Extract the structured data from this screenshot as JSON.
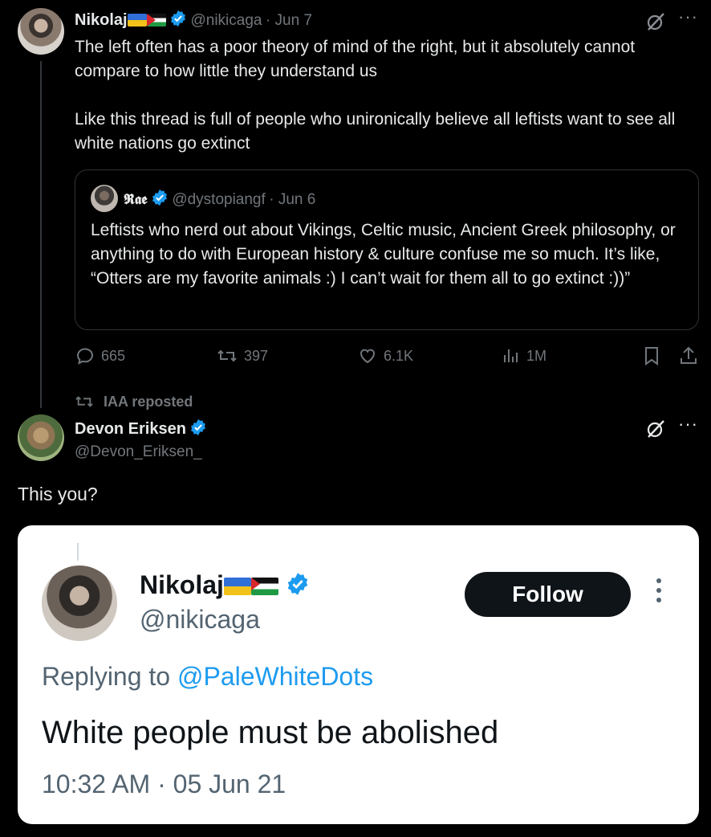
{
  "tweet": {
    "author_name": "Nikolaj",
    "author_handle": "@nikicaga",
    "date": "· Jun 7",
    "text_p1": "The left often has a poor theory of mind of the right, but it absolutely cannot compare to how little they understand us",
    "text_p2": "Like this thread is full of people who unironically believe all leftists want to see all white nations go extinct",
    "icons": [
      "grok-icon",
      "more-icon"
    ]
  },
  "quote": {
    "author_name": "𝕽𝖆𝖊",
    "author_handle": "@dystopiangf",
    "date": "· Jun 6",
    "text": "Leftists who nerd out about Vikings, Celtic music, Ancient Greek philosophy, or anything to do with European history & culture confuse me so much. It’s like, “Otters are my favorite animals :) I can’t wait for them all to go extinct :))”"
  },
  "actions": {
    "replies": "665",
    "reposts": "397",
    "likes": "6.1K",
    "views": "1M"
  },
  "repost": {
    "label": "IAA reposted",
    "author_name": "Devon Eriksen",
    "author_handle": "@Devon_Eriksen_",
    "text": "This you?"
  },
  "embedded": {
    "author_name": "Nikolaj",
    "author_handle": "@nikicaga",
    "follow_label": "Follow",
    "replying_prefix": "Replying to ",
    "replying_handle": "@PaleWhiteDots",
    "text": "White people must be abolished",
    "timestamp": "10:32 AM · 05 Jun 21"
  },
  "colors": {
    "background": "#000000",
    "text": "#e7e9ea",
    "muted": "#71767b",
    "verified": "#1d9bf0",
    "link": "#1d9bf0"
  }
}
